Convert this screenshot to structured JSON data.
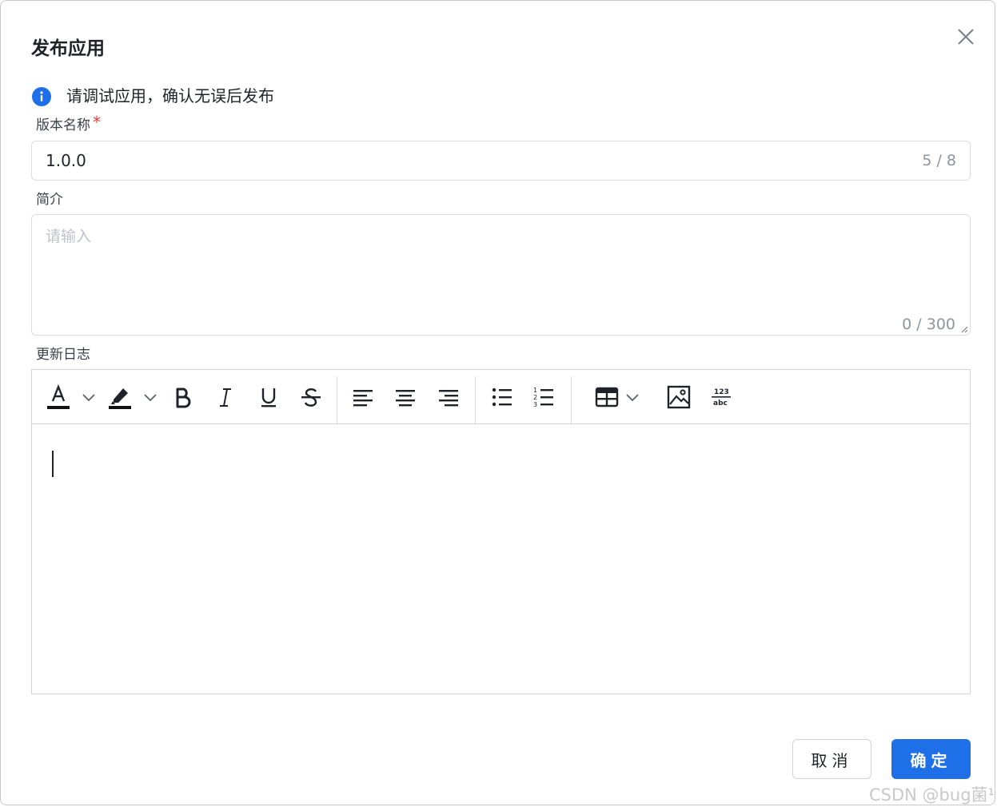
{
  "dialog": {
    "title": "发布应用",
    "notice": "请调试应用，确认无误后发布"
  },
  "version": {
    "label": "版本名称",
    "required_mark": "*",
    "value": "1.0.0",
    "counter": "5 / 8"
  },
  "intro": {
    "label": "简介",
    "placeholder": "请输入",
    "counter": "0 / 300"
  },
  "changelog": {
    "label": "更新日志",
    "toolbar": [
      "font-color",
      "font-color-dropdown",
      "highlight",
      "highlight-dropdown",
      "bold",
      "italic",
      "underline",
      "strikethrough",
      "align-left",
      "align-center",
      "align-right",
      "bullet-list",
      "numbered-list",
      "table",
      "table-dropdown",
      "image",
      "format-numbers"
    ],
    "content": ""
  },
  "buttons": {
    "cancel": "取消",
    "ok": "确定"
  },
  "watermark": "CSDN @bug菌¹",
  "colors": {
    "primary": "#1e6fe8",
    "required": "#e23b3b",
    "border": "#d9dce1",
    "placeholder": "#bfc3c9",
    "counter": "#8f959e"
  }
}
